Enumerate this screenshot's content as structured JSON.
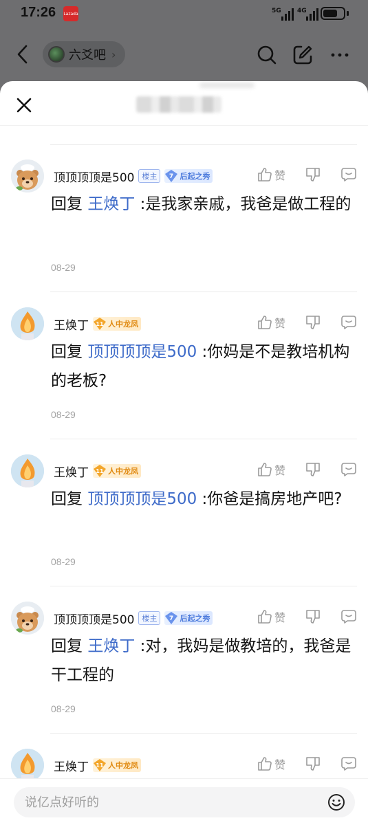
{
  "status_bar": {
    "time": "17:26",
    "app_badge": "Lazada",
    "signal1": "5G",
    "signal2": "4G",
    "battery_level": 0.7
  },
  "header": {
    "forum_name": "六爻吧",
    "chip_arrow": "›",
    "icons": [
      "back-icon",
      "search-icon",
      "edit-icon",
      "more-icon"
    ]
  },
  "sheet": {
    "icons": [
      "close-icon"
    ]
  },
  "comments": [
    {
      "user": "顶顶顶顶是500",
      "owner_badge": "楼主",
      "level": "7",
      "level_title": "后起之秀",
      "reply_prefix": "回复",
      "mention": "王焕丁",
      "text": ":是我家亲戚，我爸是做工程的",
      "date": "08-29",
      "like_label": "赞"
    },
    {
      "user": "王焕丁",
      "level": "11",
      "level_title": "人中龙凤",
      "reply_prefix": "回复",
      "mention": "顶顶顶顶是500",
      "text": ":你妈是不是教培机构的老板?",
      "date": "08-29",
      "like_label": "赞"
    },
    {
      "user": "王焕丁",
      "level": "11",
      "level_title": "人中龙凤",
      "reply_prefix": "回复",
      "mention": "顶顶顶顶是500",
      "text": ":你爸是搞房地产吧?",
      "date": "08-29",
      "like_label": "赞"
    },
    {
      "user": "顶顶顶顶是500",
      "owner_badge": "楼主",
      "level": "7",
      "level_title": "后起之秀",
      "reply_prefix": "回复",
      "mention": "王焕丁",
      "text": ":对，我妈是做教培的，我爸是干工程的",
      "date": "08-29",
      "like_label": "赞"
    },
    {
      "user": "王焕丁",
      "level": "11",
      "level_title": "人中龙凤",
      "like_label": "赞"
    }
  ],
  "input": {
    "placeholder": "说亿点好听的",
    "value": ""
  }
}
